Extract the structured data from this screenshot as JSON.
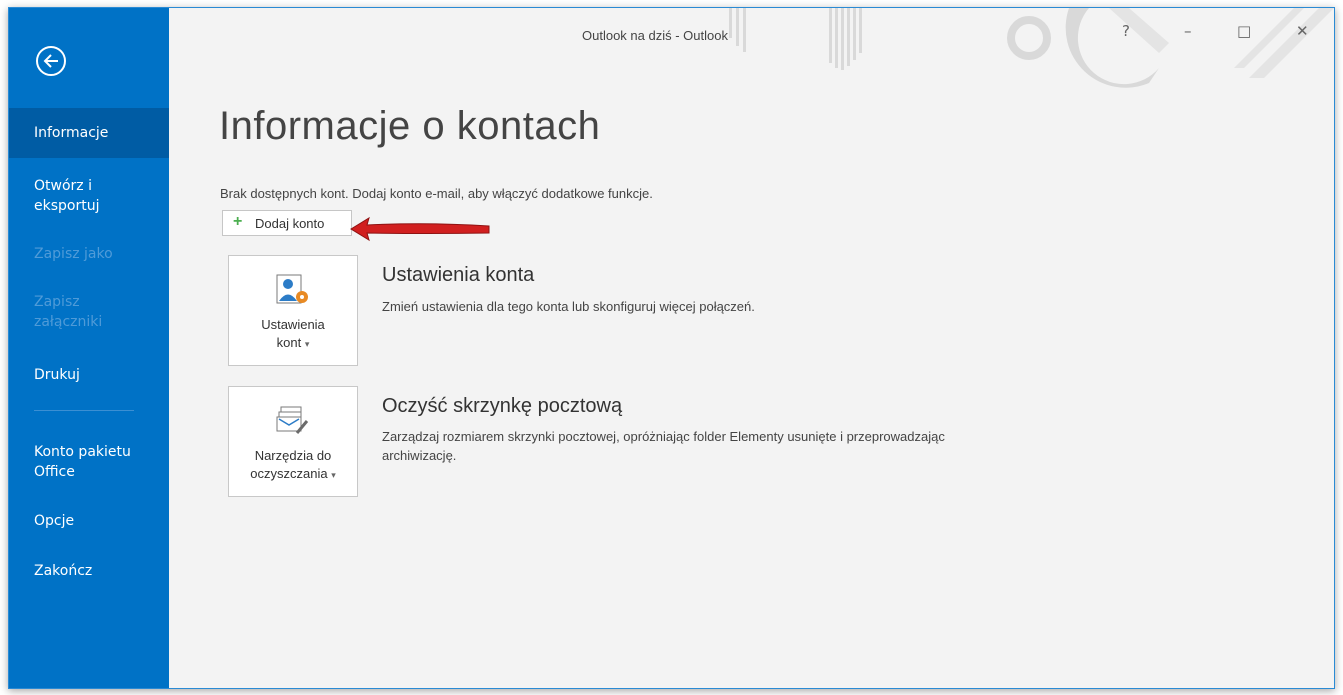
{
  "window": {
    "title": "Outlook na dziś - Outlook",
    "controls": [
      "?",
      "–",
      "□",
      "✕"
    ]
  },
  "sidebar": {
    "back_icon": "back-arrow-icon",
    "items": [
      {
        "label": "Informacje",
        "state": "selected"
      },
      {
        "label": "Otwórz i eksportuj",
        "state": "normal"
      },
      {
        "label": "Zapisz jako",
        "state": "disabled"
      },
      {
        "label": "Zapisz załączniki",
        "state": "disabled"
      },
      {
        "label": "Drukuj",
        "state": "normal"
      },
      {
        "label": "Konto pakietu Office",
        "state": "normal"
      },
      {
        "label": "Opcje",
        "state": "normal"
      },
      {
        "label": "Zakończ",
        "state": "normal"
      }
    ]
  },
  "main": {
    "title": "Informacje o kontach",
    "info_text": "Brak dostępnych kont. Dodaj konto e-mail, aby włączyć dodatkowe funkcje.",
    "add_account_label": "Dodaj konto",
    "sections": [
      {
        "tile_label_line1": "Ustawienia",
        "tile_label_line2": "kont",
        "title": "Ustawienia konta",
        "description": "Zmień ustawienia dla tego konta lub skonfiguruj więcej połączeń."
      },
      {
        "tile_label_line1": "Narzędzia do",
        "tile_label_line2": "oczyszczania",
        "title": "Oczyść skrzynkę pocztową",
        "description": "Zarządzaj rozmiarem skrzynki pocztowej, opróżniając folder Elementy usunięte i przeprowadzając archiwizację."
      }
    ]
  },
  "colors": {
    "sidebar": "#0072c6",
    "sidebar_selected": "#005ca4",
    "annotation_arrow": "#d11f1f"
  }
}
